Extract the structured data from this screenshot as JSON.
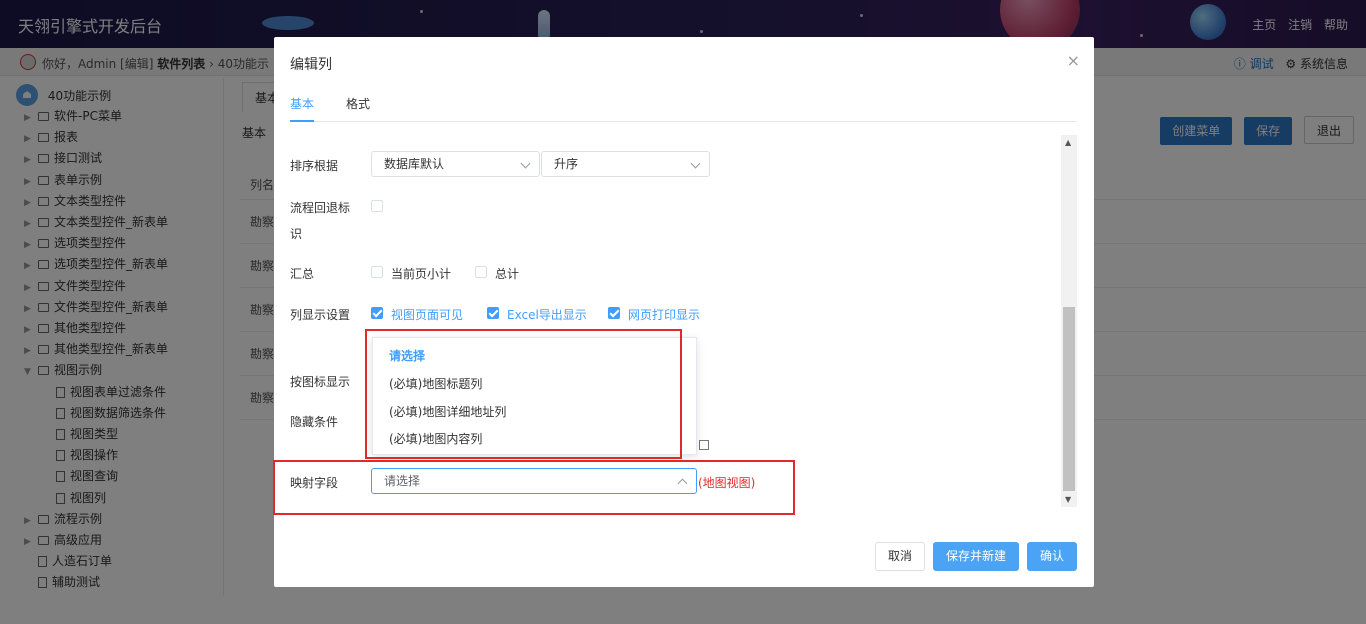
{
  "header": {
    "app_title": "天翎引擎式开发后台",
    "nav": [
      "主页",
      "注销",
      "帮助"
    ]
  },
  "breadcrumb": {
    "greeting": "你好，Admin [编辑]",
    "current": "软件列表",
    "separator": "›",
    "next": "40功能示",
    "debug": "ⓘ 调试",
    "system_info": "⚙ 系统信息"
  },
  "sidebar": {
    "root": "40功能示例",
    "items": [
      {
        "label": "软件-PC菜单",
        "type": "folder",
        "level": 1
      },
      {
        "label": "报表",
        "type": "folder",
        "level": 1
      },
      {
        "label": "接口测试",
        "type": "folder",
        "level": 1
      },
      {
        "label": "表单示例",
        "type": "folder",
        "level": 1
      },
      {
        "label": "文本类型控件",
        "type": "folder",
        "level": 1
      },
      {
        "label": "文本类型控件_新表单",
        "type": "folder",
        "level": 1
      },
      {
        "label": "选项类型控件",
        "type": "folder",
        "level": 1
      },
      {
        "label": "选项类型控件_新表单",
        "type": "folder",
        "level": 1
      },
      {
        "label": "文件类型控件",
        "type": "folder",
        "level": 1
      },
      {
        "label": "文件类型控件_新表单",
        "type": "folder",
        "level": 1
      },
      {
        "label": "其他类型控件",
        "type": "folder",
        "level": 1
      },
      {
        "label": "其他类型控件_新表单",
        "type": "folder",
        "level": 1
      },
      {
        "label": "视图示例",
        "type": "folder-open",
        "level": 1
      },
      {
        "label": "视图表单过滤条件",
        "type": "doc",
        "level": 2
      },
      {
        "label": "视图数据筛选条件",
        "type": "doc",
        "level": 2
      },
      {
        "label": "视图类型",
        "type": "doc",
        "level": 2
      },
      {
        "label": "视图操作",
        "type": "doc",
        "level": 2
      },
      {
        "label": "视图查询",
        "type": "doc",
        "level": 2
      },
      {
        "label": "视图列",
        "type": "doc",
        "level": 2
      },
      {
        "label": "流程示例",
        "type": "folder",
        "level": 1
      },
      {
        "label": "高级应用",
        "type": "folder",
        "level": 1
      },
      {
        "label": "人造石订单",
        "type": "doc",
        "level": 1
      },
      {
        "label": "辅助测试",
        "type": "doc",
        "level": 1
      }
    ]
  },
  "background": {
    "tab": "基本",
    "label": "基本",
    "buttons": [
      "创建菜单",
      "保存",
      "退出"
    ],
    "rows": [
      "列名",
      "勘察",
      "勘察",
      "勘察",
      "勘察",
      "勘察"
    ]
  },
  "dialog": {
    "title": "编辑列",
    "close": "×",
    "tabs": [
      "基本",
      "格式"
    ],
    "sort_label": "排序根据",
    "sort_by": "数据库默认",
    "sort_order": "升序",
    "flow_back_label_1": "流程回退标",
    "flow_back_label_2": "识",
    "summary_label": "汇总",
    "summary_options": [
      "当前页小计",
      "总计"
    ],
    "display_label": "列显示设置",
    "display_options": [
      "视图页面可见",
      "Excel导出显示",
      "网页打印显示"
    ],
    "icon_display_label": "按图标显示",
    "hidden_condition_label": "隐藏条件",
    "mapping_label": "映射字段",
    "mapping_value": "请选择",
    "mapping_hint": "(地图视图)",
    "dropdown_options": [
      "请选择",
      "(必填)地图标题列",
      "(必填)地图详细地址列",
      "(必填)地图内容列"
    ],
    "buttons": {
      "cancel": "取消",
      "save_new": "保存并新建",
      "confirm": "确认"
    }
  }
}
